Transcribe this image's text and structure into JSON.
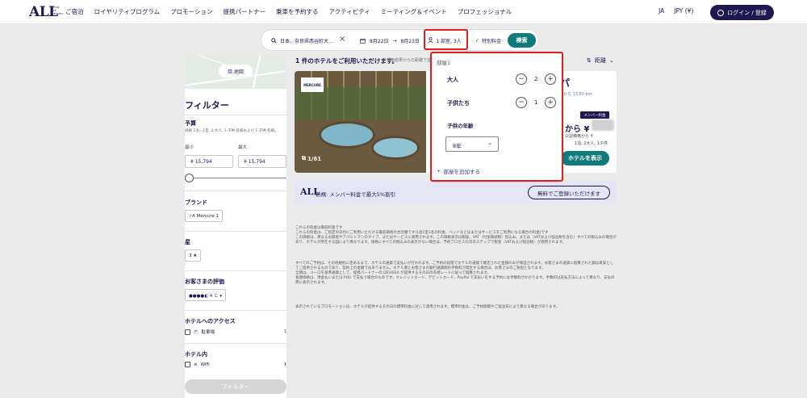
{
  "header": {
    "logo": "ALL",
    "logo_sup": "ACCOR LIVE LIMITLESS",
    "nav": [
      "ご宿泊",
      "ロイヤリティプログラム",
      "プロモーション",
      "提携パートナー",
      "乗車を予約する",
      "アクティビティ",
      "ミーティング＆イベント",
      "プロフェッショナル"
    ],
    "language": "JA",
    "currency": "JPY (¥)",
    "login_label": "ログイン / 登録"
  },
  "search": {
    "location": "日本、奈良県西谷町大...",
    "checkin": "8月22日",
    "checkout": "8月23日",
    "guests": "1 部室, 3人",
    "special_rate": "特別料金",
    "search_label": "検索"
  },
  "sidebar": {
    "map_label": "地図",
    "filter_title": "フィルター",
    "budget": {
      "title": "予算",
      "note": "価格 1泊 - 1室, 2 大人, 1 子供 名様および 1 子供 名様。",
      "min_label": "最小",
      "max_label": "最大",
      "min_value": "¥ 15,794",
      "max_value": "¥ 15,794"
    },
    "brand": {
      "title": "ブランド",
      "chip": "Mercure 1"
    },
    "stars": {
      "title": "星",
      "chip": "3 ★"
    },
    "rating": {
      "title": "お客さまの評価",
      "chip": "●●●●◐ 4 と ▾"
    },
    "access": {
      "title": "ホテルへのアクセス",
      "items": [
        {
          "label": "駐車場",
          "count": "1"
        }
      ]
    },
    "in_hotel": {
      "title": "ホテル内",
      "items": [
        {
          "label": "",
          "count": "1"
        },
        {
          "label": "WiFi",
          "count": "1"
        }
      ]
    },
    "filter_button": "フィルター"
  },
  "results": {
    "title": "1 件のホテルをご利用いただけます。",
    "subtitle": "検索結果からの距離で並...",
    "sort_label": "距離"
  },
  "hotel": {
    "brand_badge": "MERCURE",
    "image_count": "1/61",
    "name_fragment": "パ",
    "distance": "から 13.60 km",
    "member_badge": "メンバー料金",
    "price_prefix": "から ¥",
    "price_note": "公認価格から ¥",
    "price_note2": "1泊, 2大人, 1子供",
    "view_button": "ホテルを表示"
  },
  "promo": {
    "logo": "ALL",
    "text": "新規: メンバー料金で最大5%割引",
    "button": "無料でご登録いただけます"
  },
  "disclaimer": {
    "p1": [
      "これらの料金は最低料金です",
      "これらの料金は、ご指定の日付にご利用いただける最低価格の合計額です(1泊1室1名の料金、ベッドなどはまたはサービスをご利用になる場合の料金)です",
      "この価格は、異なるお部屋やアパルトマンのタイプ、またはサービスに適用されます。この価格表示は税抜、VAT（付加価値税）別込み、または（VATおよび宿泊税を含む）すべての税込みの場合があり、ホテルが所在する国により異なります。価格にすべての税込みの表示がない場合は、予約プロセスの次のステップで税金（VATおよび宿泊税）が適用されます。"
    ],
    "p2": [
      "すべてのご予約は、その他規約に定めるまで、ホテルの通貨で支払いが行われます。ご予約の段階でホテルの通貨で確定された金額のみが保証されます。お客さまの通貨に換算された額は目安としてご提供されるものであり、契約上の金額ではありません。ホテル側とお客さまの銀行通貨間の手数料が発生する場合は、お客さまのご負担となります。",
      "全期は、ユーロを基準通貨として、提携パートナーの DEVISSA が提供するその日の為替レートに従って換算されます。",
      "長期価格は、現金払いまたは POU で支払う場合のものです。クレジットカード、デビットカード、PayPal で支払いをする予約には手数料がかかります。手数料は支払方法によって異なり、支払の際に表示されます。"
    ],
    "p3": "表示されているプロモーションは、ホテルが提供するその日の標準料金に対して適用されます。標準料金は、ご予約期間やご宿泊日により異なる場合があります。"
  },
  "popup": {
    "room_label": "部屋1",
    "adults_label": "大人",
    "adults_value": "2",
    "children_label": "子供たち",
    "children_value": "1",
    "age_label": "子供の年齢",
    "age_value": "8年",
    "add_room": "部屋を追加する"
  }
}
